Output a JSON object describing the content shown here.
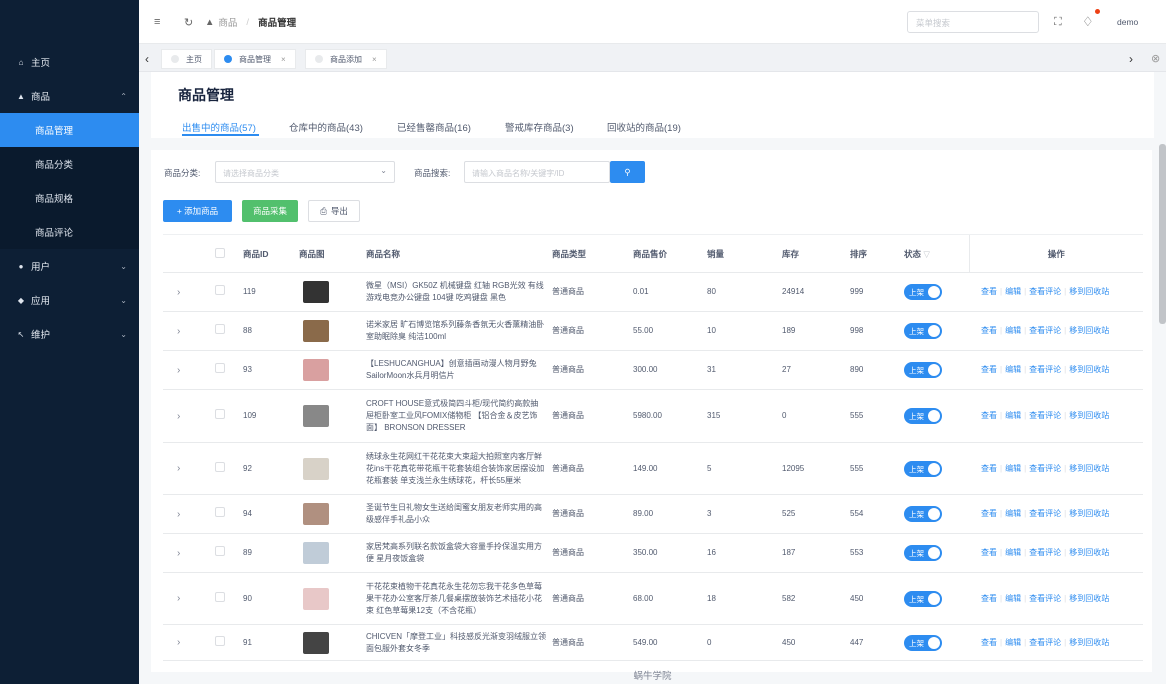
{
  "sidebar": {
    "items": [
      {
        "label": "主页",
        "icon": "home-icon",
        "expanded": false
      },
      {
        "label": "商品",
        "icon": "shop-icon",
        "expanded": true
      },
      {
        "label": "用户",
        "icon": "user-icon",
        "expanded": false
      },
      {
        "label": "应用",
        "icon": "app-icon",
        "expanded": false
      },
      {
        "label": "维护",
        "icon": "tool-icon",
        "expanded": false
      }
    ],
    "subitems": [
      "商品管理",
      "商品分类",
      "商品规格",
      "商品评论"
    ]
  },
  "header": {
    "breadcrumb_home": "商品",
    "breadcrumb_sep": "/",
    "breadcrumb_current": "商品管理",
    "search_placeholder": "菜单搜索",
    "user": "demo"
  },
  "tabs": [
    {
      "label": "主页",
      "closable": false
    },
    {
      "label": "商品管理",
      "closable": true,
      "active": true
    },
    {
      "label": "商品添加",
      "closable": true
    }
  ],
  "page": {
    "title": "商品管理",
    "subtabs": [
      "出售中的商品(57)",
      "仓库中的商品(43)",
      "已经售罄商品(16)",
      "警戒库存商品(3)",
      "回收站的商品(19)"
    ]
  },
  "filters": {
    "category_label": "商品分类:",
    "category_placeholder": "请选择商品分类",
    "search_label": "商品搜索:",
    "search_placeholder": "请输入商品名称/关键字/ID"
  },
  "buttons": {
    "add": "+ 添加商品",
    "collect": "商品采集",
    "export": "导出"
  },
  "table": {
    "headers": [
      "商品ID",
      "商品图",
      "商品名称",
      "商品类型",
      "商品售价",
      "销量",
      "库存",
      "排序",
      "状态",
      "操作"
    ],
    "status_label": "上架",
    "ops": [
      "查看",
      "编辑",
      "查看评论",
      "移到回收站"
    ],
    "rows": [
      {
        "id": "119",
        "name": "微星（MSI）GK50Z 机械键盘 红轴 RGB光效 有线 游戏电竞办公键盘 104键 吃鸡键盘 黑色",
        "type": "普通商品",
        "price": "0.01",
        "sales": "80",
        "stock": "24914",
        "sort": "999"
      },
      {
        "id": "88",
        "name": "诺米家居 旷石博览馆系列藤条香氛无火香薰精油卧室助眠除臭 纯洁100ml",
        "type": "普通商品",
        "price": "55.00",
        "sales": "10",
        "stock": "189",
        "sort": "998"
      },
      {
        "id": "93",
        "name": "【LESHUCANGHUA】创意插画动漫人物月野兔SailorMoon水兵月明信片",
        "type": "普通商品",
        "price": "300.00",
        "sales": "31",
        "stock": "27",
        "sort": "890"
      },
      {
        "id": "109",
        "name": "CROFT HOUSE意式极简四斗柜/现代简约高款抽屉柜卧室工业风FOMIX储物柜 【铝合金＆皮艺饰面】 BRONSON DRESSER",
        "type": "普通商品",
        "price": "5980.00",
        "sales": "315",
        "stock": "0",
        "sort": "555"
      },
      {
        "id": "92",
        "name": "绣球永生花网红干花花束大束超大拍照室内客厅鲜花ins干花真花带花瓶干花套装组合装饰家居摆设加花瓶套装 单支浅兰永生绣球花，杆长55厘米",
        "type": "普通商品",
        "price": "149.00",
        "sales": "5",
        "stock": "12095",
        "sort": "555"
      },
      {
        "id": "94",
        "name": "圣诞节生日礼物女生送给闺蜜女朋友老师实用的高级感伴手礼品小众",
        "type": "普通商品",
        "price": "89.00",
        "sales": "3",
        "stock": "525",
        "sort": "554"
      },
      {
        "id": "89",
        "name": "家居梵高系列联名款饭盒袋大容量手拎保温实用方便 星月夜饭盒袋",
        "type": "普通商品",
        "price": "350.00",
        "sales": "16",
        "stock": "187",
        "sort": "553"
      },
      {
        "id": "90",
        "name": "干花花束植物干花真花永生花勿忘我干花多色草莓果干花办公室客厅茶几餐桌摆放装饰艺术插花小花束 红色草莓果12支（不含花瓶）",
        "type": "普通商品",
        "price": "68.00",
        "sales": "18",
        "stock": "582",
        "sort": "450"
      },
      {
        "id": "91",
        "name": "CHICVEN「摩登工业」科技感反光渐变羽绒服立领面包服外套女冬季",
        "type": "普通商品",
        "price": "549.00",
        "sales": "0",
        "stock": "450",
        "sort": "447"
      }
    ]
  },
  "footer": "蜗牛学院",
  "colors": {
    "sidebar": "#0d1f35",
    "accent": "#2d8cf0",
    "collect": "#52c06d"
  }
}
